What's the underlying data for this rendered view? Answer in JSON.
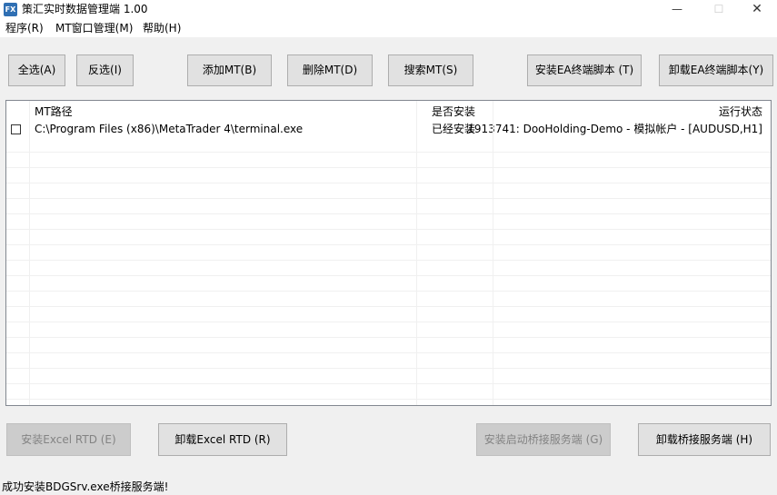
{
  "window": {
    "title": "策汇实时数据管理端 1.00",
    "icon_text": "FX",
    "minimize_glyph": "—",
    "maximize_glyph": "☐",
    "close_glyph": "✕"
  },
  "menu": {
    "items": [
      "程序(R)",
      "MT窗口管理(M)",
      "帮助(H)"
    ]
  },
  "toolbar": {
    "select_all": "全选(A)",
    "invert_select": "反选(I)",
    "add_mt": "添加MT(B)",
    "delete_mt": "删除MT(D)",
    "search_mt": "搜索MT(S)",
    "install_ea": "安装EA终端脚本 (T)",
    "uninstall_ea": "卸载EA终端脚本(Y)"
  },
  "table": {
    "columns": [
      "MT路径",
      "是否安装",
      "运行状态"
    ],
    "rows": [
      {
        "checked": false,
        "path": "C:\\Program Files (x86)\\MetaTrader 4\\terminal.exe",
        "installed": "已经安装",
        "status": "1913741: DooHolding-Demo - 模拟帐户 - [AUDUSD,H1]"
      }
    ]
  },
  "bottom_buttons": {
    "install_excel_rtd": "安装Excel RTD (E)",
    "uninstall_excel_rtd": "卸载Excel RTD (R)",
    "install_bridge": "安装启动桥接服务端 (G)",
    "uninstall_bridge": "卸载桥接服务端 (H)"
  },
  "status_bar": {
    "message": "成功安装BDGSrv.exe桥接服务端!"
  }
}
